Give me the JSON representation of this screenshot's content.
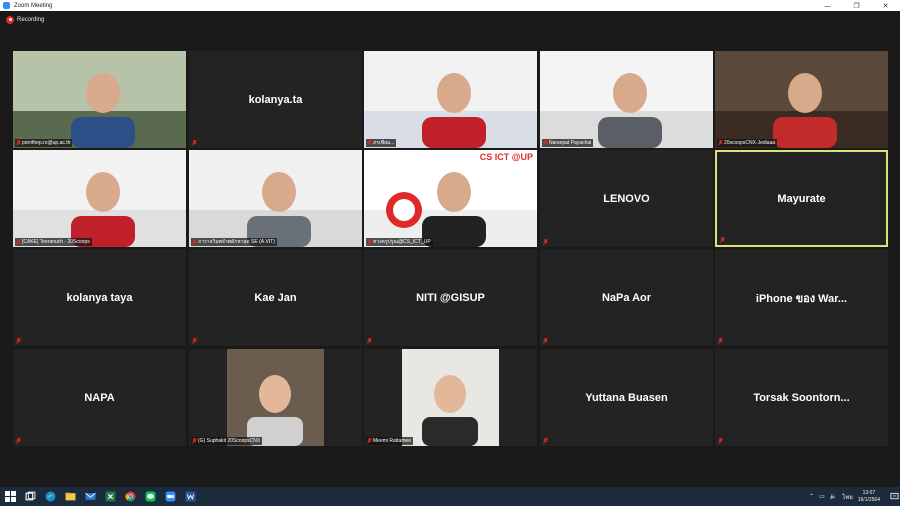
{
  "window": {
    "title": "Zoom Meeting",
    "min": "—",
    "max": "❐",
    "close": "✕"
  },
  "recording": {
    "label": "Recording"
  },
  "participants": [
    {
      "label": "pornthep.ro@up.ac.th",
      "video": true
    },
    {
      "label": "kolanya.ta",
      "video": false
    },
    {
      "label": "ภรเซียม...",
      "video": true
    },
    {
      "label": "Narsepat Payachai",
      "video": true
    },
    {
      "label": "20scoopsCNX-Jediaaa",
      "video": true
    },
    {
      "label": "[CAKE] Teeranuch - 20Scoops",
      "video": true
    },
    {
      "label": "ภาราจวิมพจำพดักหาสุด SE (A.VIT)",
      "video": true
    },
    {
      "label": "ทางครูปรูณ@CS_ICT_UP",
      "video": true,
      "overlay": "CS ICT @UP"
    },
    {
      "label": "LENOVO",
      "video": false
    },
    {
      "label": "Mayurate",
      "video": false,
      "active": true
    },
    {
      "label": "kolanya taya",
      "video": false
    },
    {
      "label": "Kae Jan",
      "video": false
    },
    {
      "label": "NITI @GISUP",
      "video": false
    },
    {
      "label": "NaPa Aor",
      "video": false
    },
    {
      "label": "iPhone ของ War...",
      "video": false
    },
    {
      "label": "NAPA",
      "video": false
    },
    {
      "label": "(G) Suphakit 20ScoopsCNX",
      "video": true
    },
    {
      "label": "Meemi Rattamee",
      "video": true
    },
    {
      "label": "Yuttana Buasen",
      "video": false
    },
    {
      "label": "Torsak  Soontorn...",
      "video": false
    }
  ],
  "taskbar": {
    "apps": [
      "windows-start-icon",
      "task-view-icon",
      "edge-icon",
      "file-explorer-icon",
      "mail-icon",
      "excel-icon",
      "chrome-icon",
      "line-icon",
      "zoom-icon",
      "word-icon"
    ],
    "tray": {
      "chevron": "⌃",
      "lang": "ไทย",
      "time": "13:07",
      "date": "16/1/2564"
    }
  },
  "colors": {
    "tile_bg": "#232323",
    "page_bg": "#1a1a1a",
    "active_border": "#d8e37a",
    "muted_red": "#e02828",
    "taskbar": "#1c2b3c"
  }
}
